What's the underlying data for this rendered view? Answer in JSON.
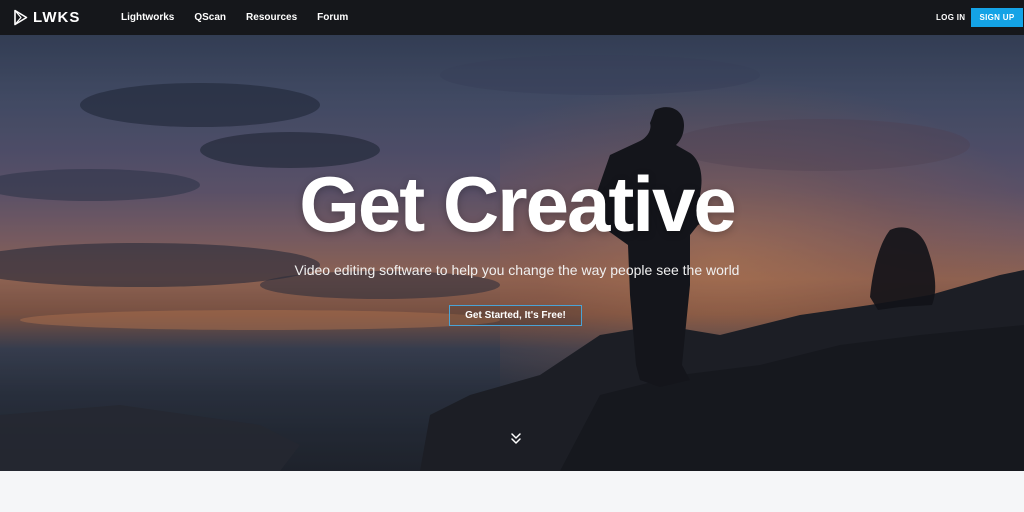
{
  "brand": {
    "name": "LWKS",
    "logo_icon": "play-triangle-icon"
  },
  "nav": {
    "links": [
      "Lightworks",
      "QScan",
      "Resources",
      "Forum"
    ],
    "login_label": "LOG IN",
    "signup_label": "SIGN UP"
  },
  "hero": {
    "title": "Get Creative",
    "subtitle": "Video editing software to help you change the way people see the world",
    "cta_label": "Get Started, It's Free!",
    "scroll_icon": "double-chevron-down-icon"
  },
  "colors": {
    "navbar_bg": "#15171b",
    "accent": "#14a3e6",
    "cta_border": "#4aa3d6",
    "page_bg": "#f5f6f8"
  }
}
